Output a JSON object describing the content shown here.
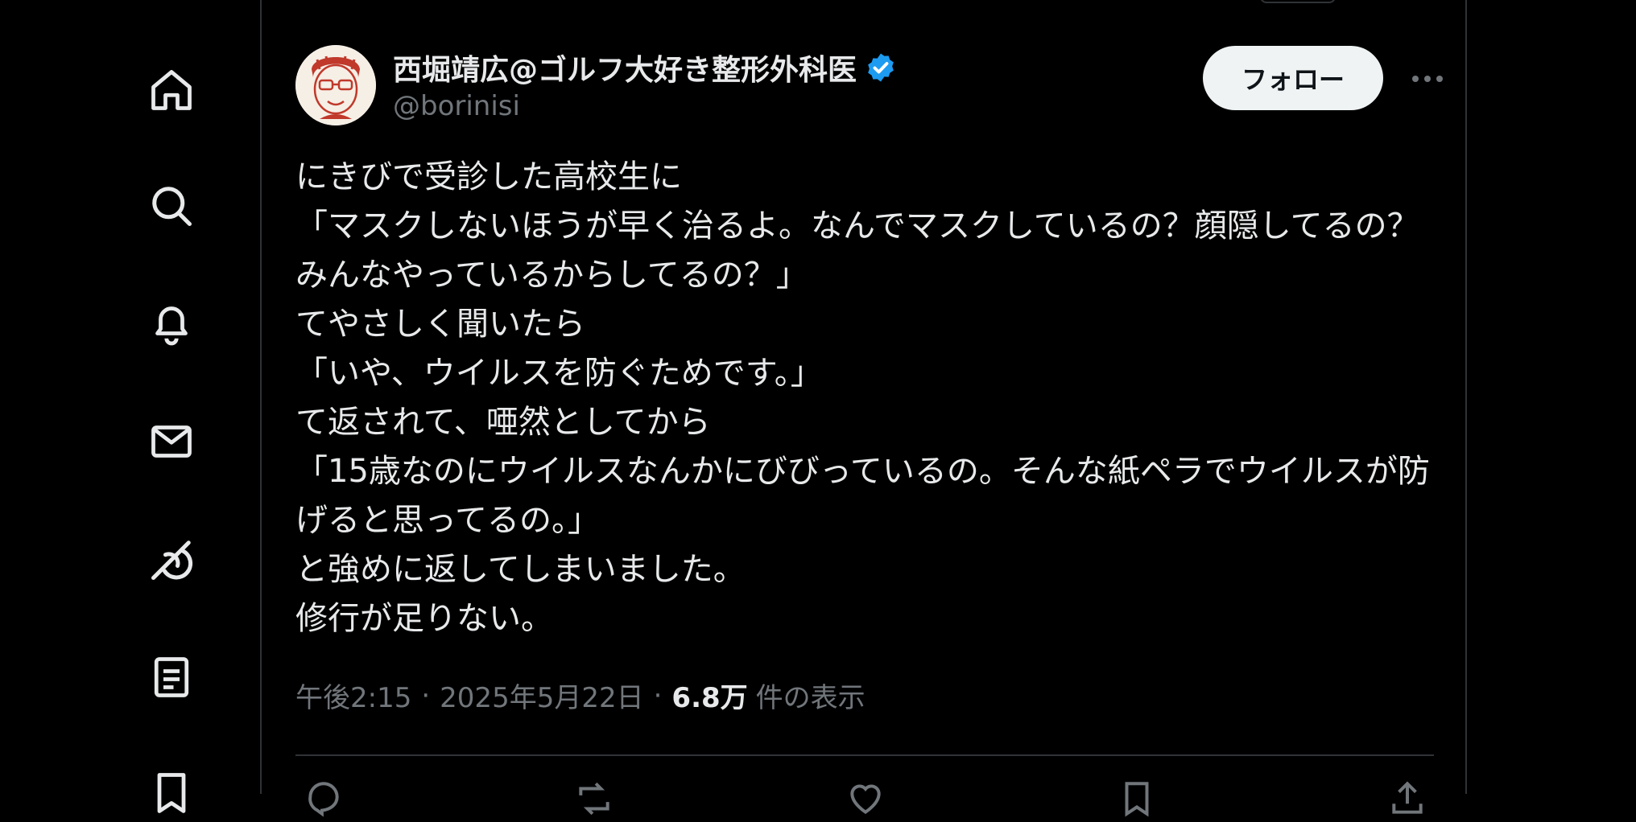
{
  "sidebar": {
    "items": [
      {
        "icon": "home-icon"
      },
      {
        "icon": "search-icon"
      },
      {
        "icon": "bell-icon"
      },
      {
        "icon": "mail-icon"
      },
      {
        "icon": "grok-icon"
      },
      {
        "icon": "lists-icon"
      },
      {
        "icon": "bookmark-icon"
      }
    ]
  },
  "tweet": {
    "author": {
      "display_name": "西堀靖広@ゴルフ大好き整形外科医",
      "handle": "@borinisi",
      "verified": true
    },
    "follow_label": "フォロー",
    "text": "にきびで受診した高校生に\n「マスクしないほうが早く治るよ。なんでマスクしているの？顔隠してるの？みんなやっているからしてるの？」\nてやさしく聞いたら\n「いや、ウイルスを防ぐためです。」\nて返されて、唖然としてから\n「15歳なのにウイルスなんかにびびっているの。そんな紙ペラでウイルスが防げると思ってるの。」\nと強めに返してしまいました。\n修行が足りない。",
    "time": "午後2:15",
    "date": "2025年5月22日",
    "views_count": "6.8万",
    "views_label": "件の表示",
    "separator": "·"
  },
  "colors": {
    "background": "#000000",
    "text": "#e7e9ea",
    "secondary_text": "#71767b",
    "border": "#2f3336",
    "verified_badge": "#1d9bf0",
    "follow_button_bg": "#eff3f4"
  }
}
